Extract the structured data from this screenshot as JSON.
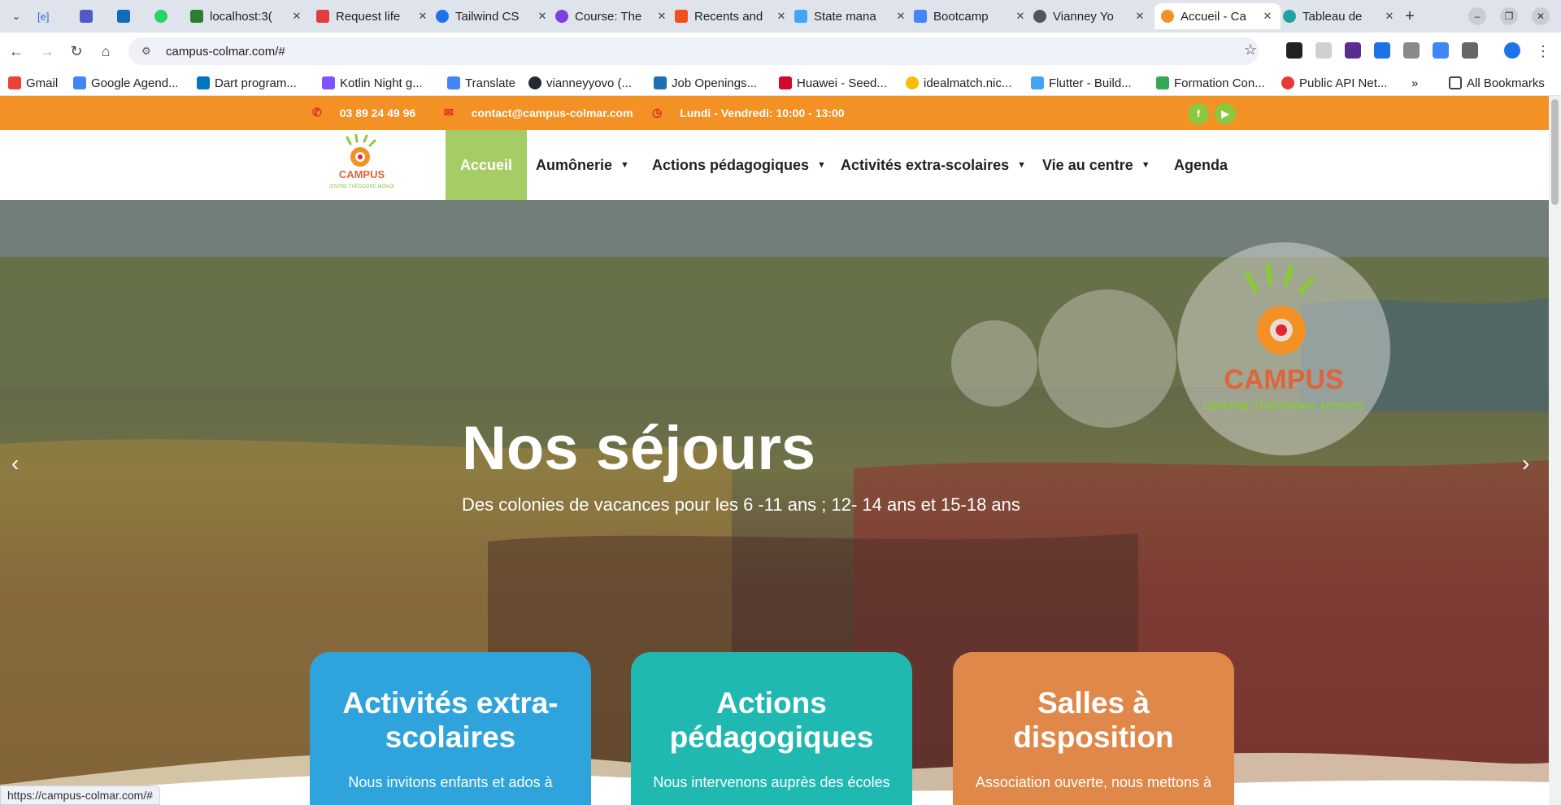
{
  "browser": {
    "tabs": [
      {
        "label": "[e]",
        "color": "#3367d6",
        "active": false
      },
      {
        "label": "",
        "color": "#5059c9",
        "active": false
      },
      {
        "label": "",
        "color": "#0f6cbd",
        "active": false
      },
      {
        "label": "",
        "color": "#25d366",
        "active": false
      },
      {
        "label": "localhost:3(",
        "color": "#2e7d32",
        "active": false
      },
      {
        "label": "Request life",
        "color": "#e03e3e",
        "active": false
      },
      {
        "label": "Tailwind CS",
        "color": "#1a73e8",
        "active": false
      },
      {
        "label": "Course: The",
        "color": "#7b3fe4",
        "active": false
      },
      {
        "label": "Recents and",
        "color": "#f24e1e",
        "active": false
      },
      {
        "label": "State mana",
        "color": "#42a5f5",
        "active": false
      },
      {
        "label": "Bootcamp",
        "color": "#4285f4",
        "active": false
      },
      {
        "label": "Vianney Yo",
        "color": "#555555",
        "active": false
      },
      {
        "label": "Accueil - Ca",
        "color": "#f39125",
        "active": true
      },
      {
        "label": "Tableau de",
        "color": "#20a4a0",
        "active": false
      }
    ],
    "url": "campus-colmar.com/#",
    "bookmarks": [
      {
        "label": "Gmail",
        "color": "#ea4335"
      },
      {
        "label": "Google Agend...",
        "color": "#4285f4"
      },
      {
        "label": "Dart program...",
        "color": "#0175c2"
      },
      {
        "label": "Kotlin Night g...",
        "color": "#7f52ff"
      },
      {
        "label": "Translate",
        "color": "#4285f4"
      },
      {
        "label": "vianneyyovo (...",
        "color": "#24292f"
      },
      {
        "label": "Job Openings...",
        "color": "#1f6fb5"
      },
      {
        "label": "Huawei - Seed...",
        "color": "#cf0a2c"
      },
      {
        "label": "idealmatch.nic...",
        "color": "#f6c000"
      },
      {
        "label": "Flutter - Build...",
        "color": "#42a5f5"
      },
      {
        "label": "Formation Con...",
        "color": "#34a853"
      },
      {
        "label": "Public API Net...",
        "color": "#e53935"
      }
    ],
    "more_bookmarks": "»",
    "all_bookmarks": "All Bookmarks",
    "status_url": "https://campus-colmar.com/#"
  },
  "site": {
    "topbar": {
      "phone": "03 89 24 49 96",
      "email": "contact@campus-colmar.com",
      "hours": "Lundi - Vendredi: 10:00 - 13:00",
      "accent": "#f39125"
    },
    "logo": {
      "text": "CAMPUS",
      "subtext": "CENTRE THÉODORE MONOD"
    },
    "nav": [
      {
        "label": "Accueil",
        "active": true,
        "dropdown": false
      },
      {
        "label": "Aumônerie",
        "active": false,
        "dropdown": true
      },
      {
        "label": "Actions pédagogiques",
        "active": false,
        "dropdown": true
      },
      {
        "label": "Activités extra-scolaires",
        "active": false,
        "dropdown": true
      },
      {
        "label": "Vie au centre",
        "active": false,
        "dropdown": true
      },
      {
        "label": "Agenda",
        "active": false,
        "dropdown": false
      }
    ],
    "hero": {
      "title": "Nos séjours",
      "subtitle": "Des colonies de vacances pour les 6 -11 ans ; 12- 14 ans et 15-18 ans",
      "prev": "‹",
      "next": "›"
    },
    "cards": [
      {
        "title_line1": "Activités extra-",
        "title_line2": "scolaires",
        "text": "Nous invitons enfants et ados à",
        "color": "#2fa4dc"
      },
      {
        "title_line1": "Actions",
        "title_line2": "pédagogiques",
        "text": "Nous intervenons auprès des écoles",
        "color": "#20b9b1"
      },
      {
        "title_line1": "Salles à",
        "title_line2": "disposition",
        "text": "Association ouverte, nous mettons à",
        "color": "#e0884a"
      }
    ]
  }
}
